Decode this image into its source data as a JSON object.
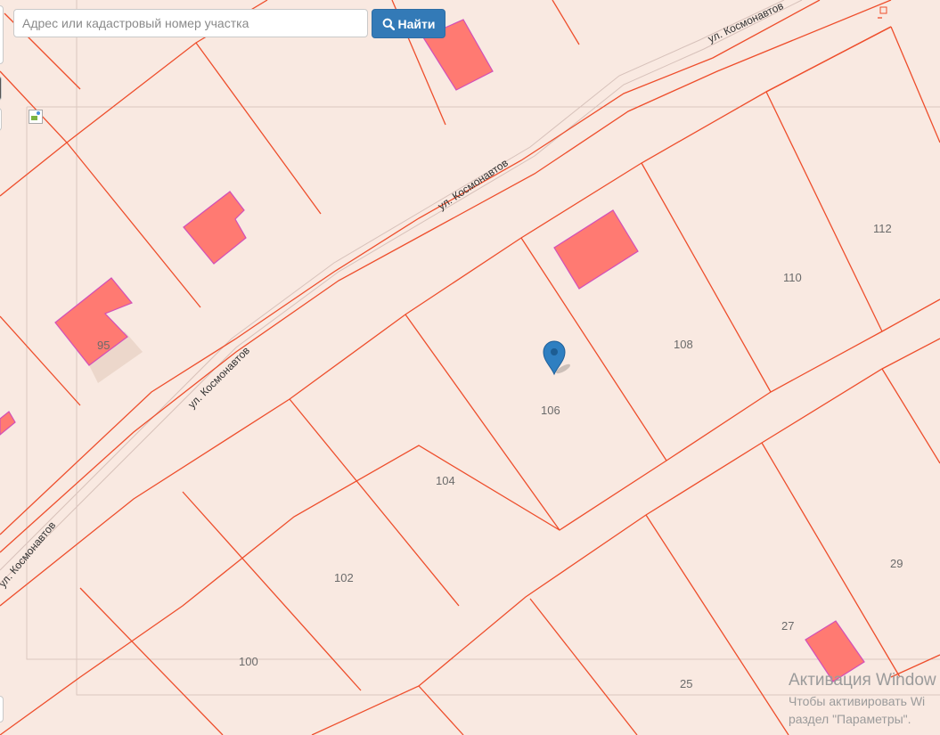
{
  "search": {
    "placeholder": "Адрес или кадастровый номер участка",
    "value": "",
    "button_label": "Найти",
    "button_icon": "search-icon"
  },
  "map": {
    "street_labels": [
      "ул. Космонавтов",
      "ул. Космонавтов",
      "ул. Космонавтов",
      "ул. Космонавтов"
    ],
    "plot_numbers": [
      "95",
      "100",
      "102",
      "104",
      "106",
      "108",
      "110",
      "112",
      "25",
      "27",
      "29"
    ],
    "marker_icon": "map-pin-icon",
    "colors": {
      "background": "#f9e9e1",
      "parcel_boundary": "#ee4e2c",
      "building_fill": "#ff7a72",
      "building_outline": "#d24fb8",
      "marker": "#2f7fc1"
    }
  },
  "watermark": {
    "title": "Активация Window",
    "line1": "Чтобы активировать Wi",
    "line2": "раздел \"Параметры\"."
  }
}
